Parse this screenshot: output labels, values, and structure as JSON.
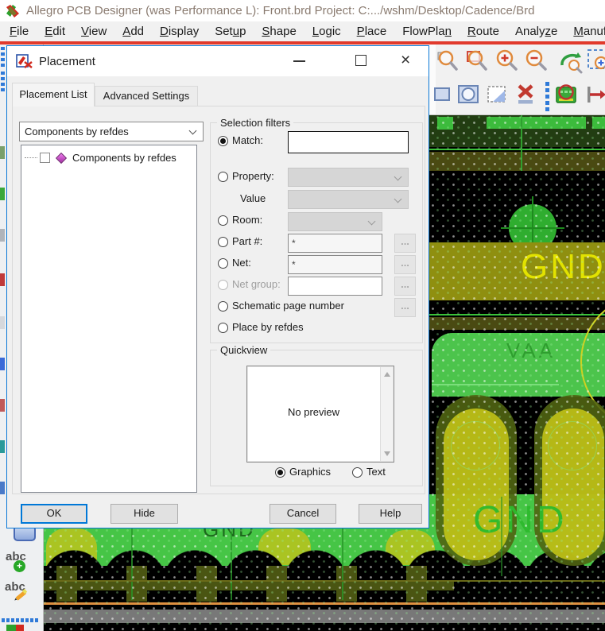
{
  "window": {
    "title": "Allegro PCB Designer (was Performance L): Front.brd  Project: C:.../wshm/Desktop/Cadence/Brd"
  },
  "menu": {
    "items": [
      {
        "pre": "",
        "m": "F",
        "post": "ile"
      },
      {
        "pre": "",
        "m": "E",
        "post": "dit"
      },
      {
        "pre": "",
        "m": "V",
        "post": "iew"
      },
      {
        "pre": "",
        "m": "A",
        "post": "dd"
      },
      {
        "pre": "",
        "m": "D",
        "post": "isplay"
      },
      {
        "pre": "Set",
        "m": "u",
        "post": "p"
      },
      {
        "pre": "",
        "m": "S",
        "post": "hape"
      },
      {
        "pre": "",
        "m": "L",
        "post": "ogic"
      },
      {
        "pre": "",
        "m": "P",
        "post": "lace"
      },
      {
        "pre": "FlowPla",
        "m": "n",
        "post": ""
      },
      {
        "pre": "",
        "m": "R",
        "post": "oute"
      },
      {
        "pre": "Analy",
        "m": "z",
        "post": "e"
      },
      {
        "pre": "",
        "m": "M",
        "post": "anufa"
      }
    ]
  },
  "side_toolbar": {
    "abc_add": "abc",
    "abc_edit": "abc"
  },
  "top_toolbar": {
    "zoom_tools": [
      "zoom-points",
      "zoom-rect",
      "zoom-in",
      "zoom-out",
      "zoom-previous",
      "zoom-fit"
    ],
    "draw_tools": [
      "rect-tool",
      "circle-tool",
      "dashed-rect-tool",
      "delete-tool",
      "highlight-component-tool",
      "move-ref-tool"
    ]
  },
  "dialog": {
    "title": "Placement",
    "tabs": [
      "Placement List",
      "Advanced Settings"
    ],
    "list_dropdown_value": "Components by refdes",
    "tree_item_label": "Components by refdes",
    "filters": {
      "legend": "Selection filters",
      "match_label": "Match:",
      "match_value": "",
      "property_label": "Property:",
      "value_label": "Value",
      "room_label": "Room:",
      "part_label": "Part #:",
      "part_value": "*",
      "net_label": "Net:",
      "net_value": "*",
      "netgroup_label": "Net group:",
      "netgroup_value": "",
      "schematic_label": "Schematic page number",
      "refdes_label": "Place by refdes",
      "browse_label": "..."
    },
    "quickview": {
      "legend": "Quickview",
      "empty_text": "No preview",
      "graphics_label": "Graphics",
      "text_label": "Text"
    },
    "buttons": {
      "ok": "OK",
      "hide": "Hide",
      "cancel": "Cancel",
      "help": "Help"
    }
  },
  "pcb": {
    "labels": {
      "gnd_top": "GND",
      "vaa": "VAA",
      "gnd_bottom": "GND",
      "gnd_small": "GND"
    }
  },
  "colors": {
    "accent_blue": "#0078d7",
    "menu_red_line": "#e13a2c",
    "pcb_bright_green": "#46c546",
    "pcb_olive_band": "#8f8f10",
    "pcb_yellow_text": "#e2e200",
    "pcb_green_text": "#2db52d",
    "orange_line": "#df9040",
    "gray_band": "#787878"
  }
}
